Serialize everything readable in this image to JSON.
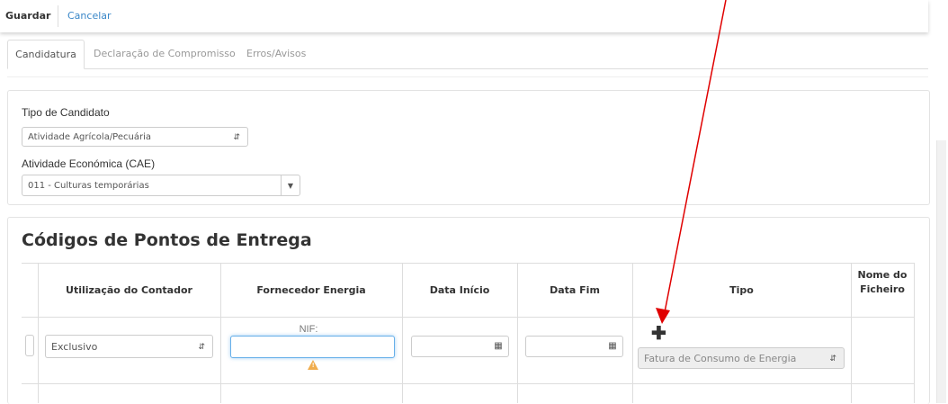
{
  "toolbar": {
    "save_label": "Guardar",
    "cancel_label": "Cancelar"
  },
  "tabs": [
    {
      "label": "Candidatura",
      "active": true
    },
    {
      "label": "Declaração de Compromisso",
      "active": false
    },
    {
      "label": "Erros/Avisos",
      "active": false
    }
  ],
  "form": {
    "tipo_label": "Tipo de Candidato",
    "tipo_value": "Atividade Agrícola/Pecuária",
    "cae_label": "Atividade Económica (CAE)",
    "cae_value": "011 - Culturas temporárias"
  },
  "section": {
    "title": "Códigos de Pontos de Entrega",
    "headers": [
      "Utilização do Contador",
      "Fornecedor Energia",
      "Data Início",
      "Data Fim",
      "Tipo",
      "Nome do Ficheiro"
    ],
    "row": {
      "utilizacao": "Exclusivo",
      "nif_label": "NIF:",
      "tipo_value": "Fatura de Consumo de Energia"
    }
  },
  "colors": {
    "accent": "#3a87c8",
    "warning": "#f0ad4e",
    "annotation_arrow": "#e00000"
  },
  "icons": [
    "calendar-icon",
    "warning-icon",
    "plus-icon",
    "chevron-updown-icon",
    "caret-down-icon"
  ]
}
